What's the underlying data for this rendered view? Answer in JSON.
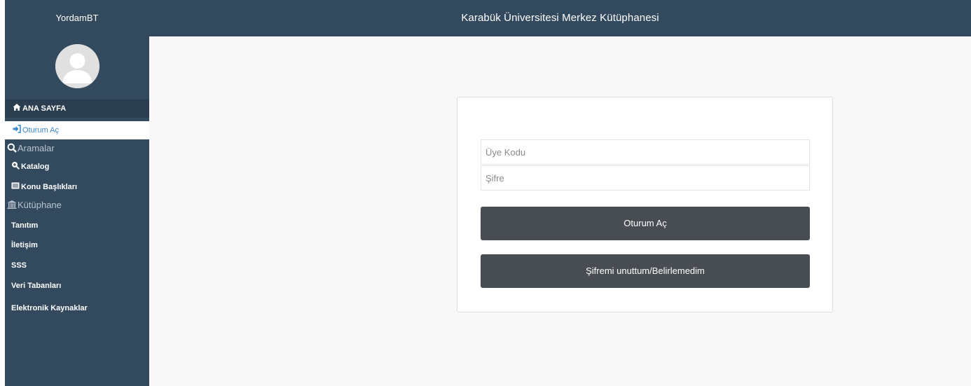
{
  "header": {
    "brand": "YordamBT",
    "site_title": "Karabük Üniversitesi Merkez Kütüphanesi"
  },
  "sidebar": {
    "home": "ANA SAYFA",
    "login": "Oturum Aç",
    "searches_section": "Aramalar",
    "catalog": "Katalog",
    "subjects": "Konu Başlıkları",
    "library_section": "Kütüphane",
    "intro": "Tanıtım",
    "contact": "İletişim",
    "faq": "SSS",
    "databases": "Veri Tabanları",
    "e_resources": "Elektronik Kaynaklar"
  },
  "login_form": {
    "member_code_placeholder": "Üye Kodu",
    "member_code_value": "",
    "password_placeholder": "Şifre",
    "password_value": "",
    "login_button": "Oturum Aç",
    "forgot_button": "Şifremi unuttum/Belirlemedim"
  },
  "colors": {
    "navbar": "#334a5e",
    "active_link": "#3a87c8",
    "button": "#474d53"
  },
  "icons": {
    "home": "home-icon",
    "login": "sign-in-icon",
    "search": "search-icon",
    "catalog": "zoom-in-icon",
    "subjects": "list-alt-icon",
    "library": "institution-icon"
  }
}
